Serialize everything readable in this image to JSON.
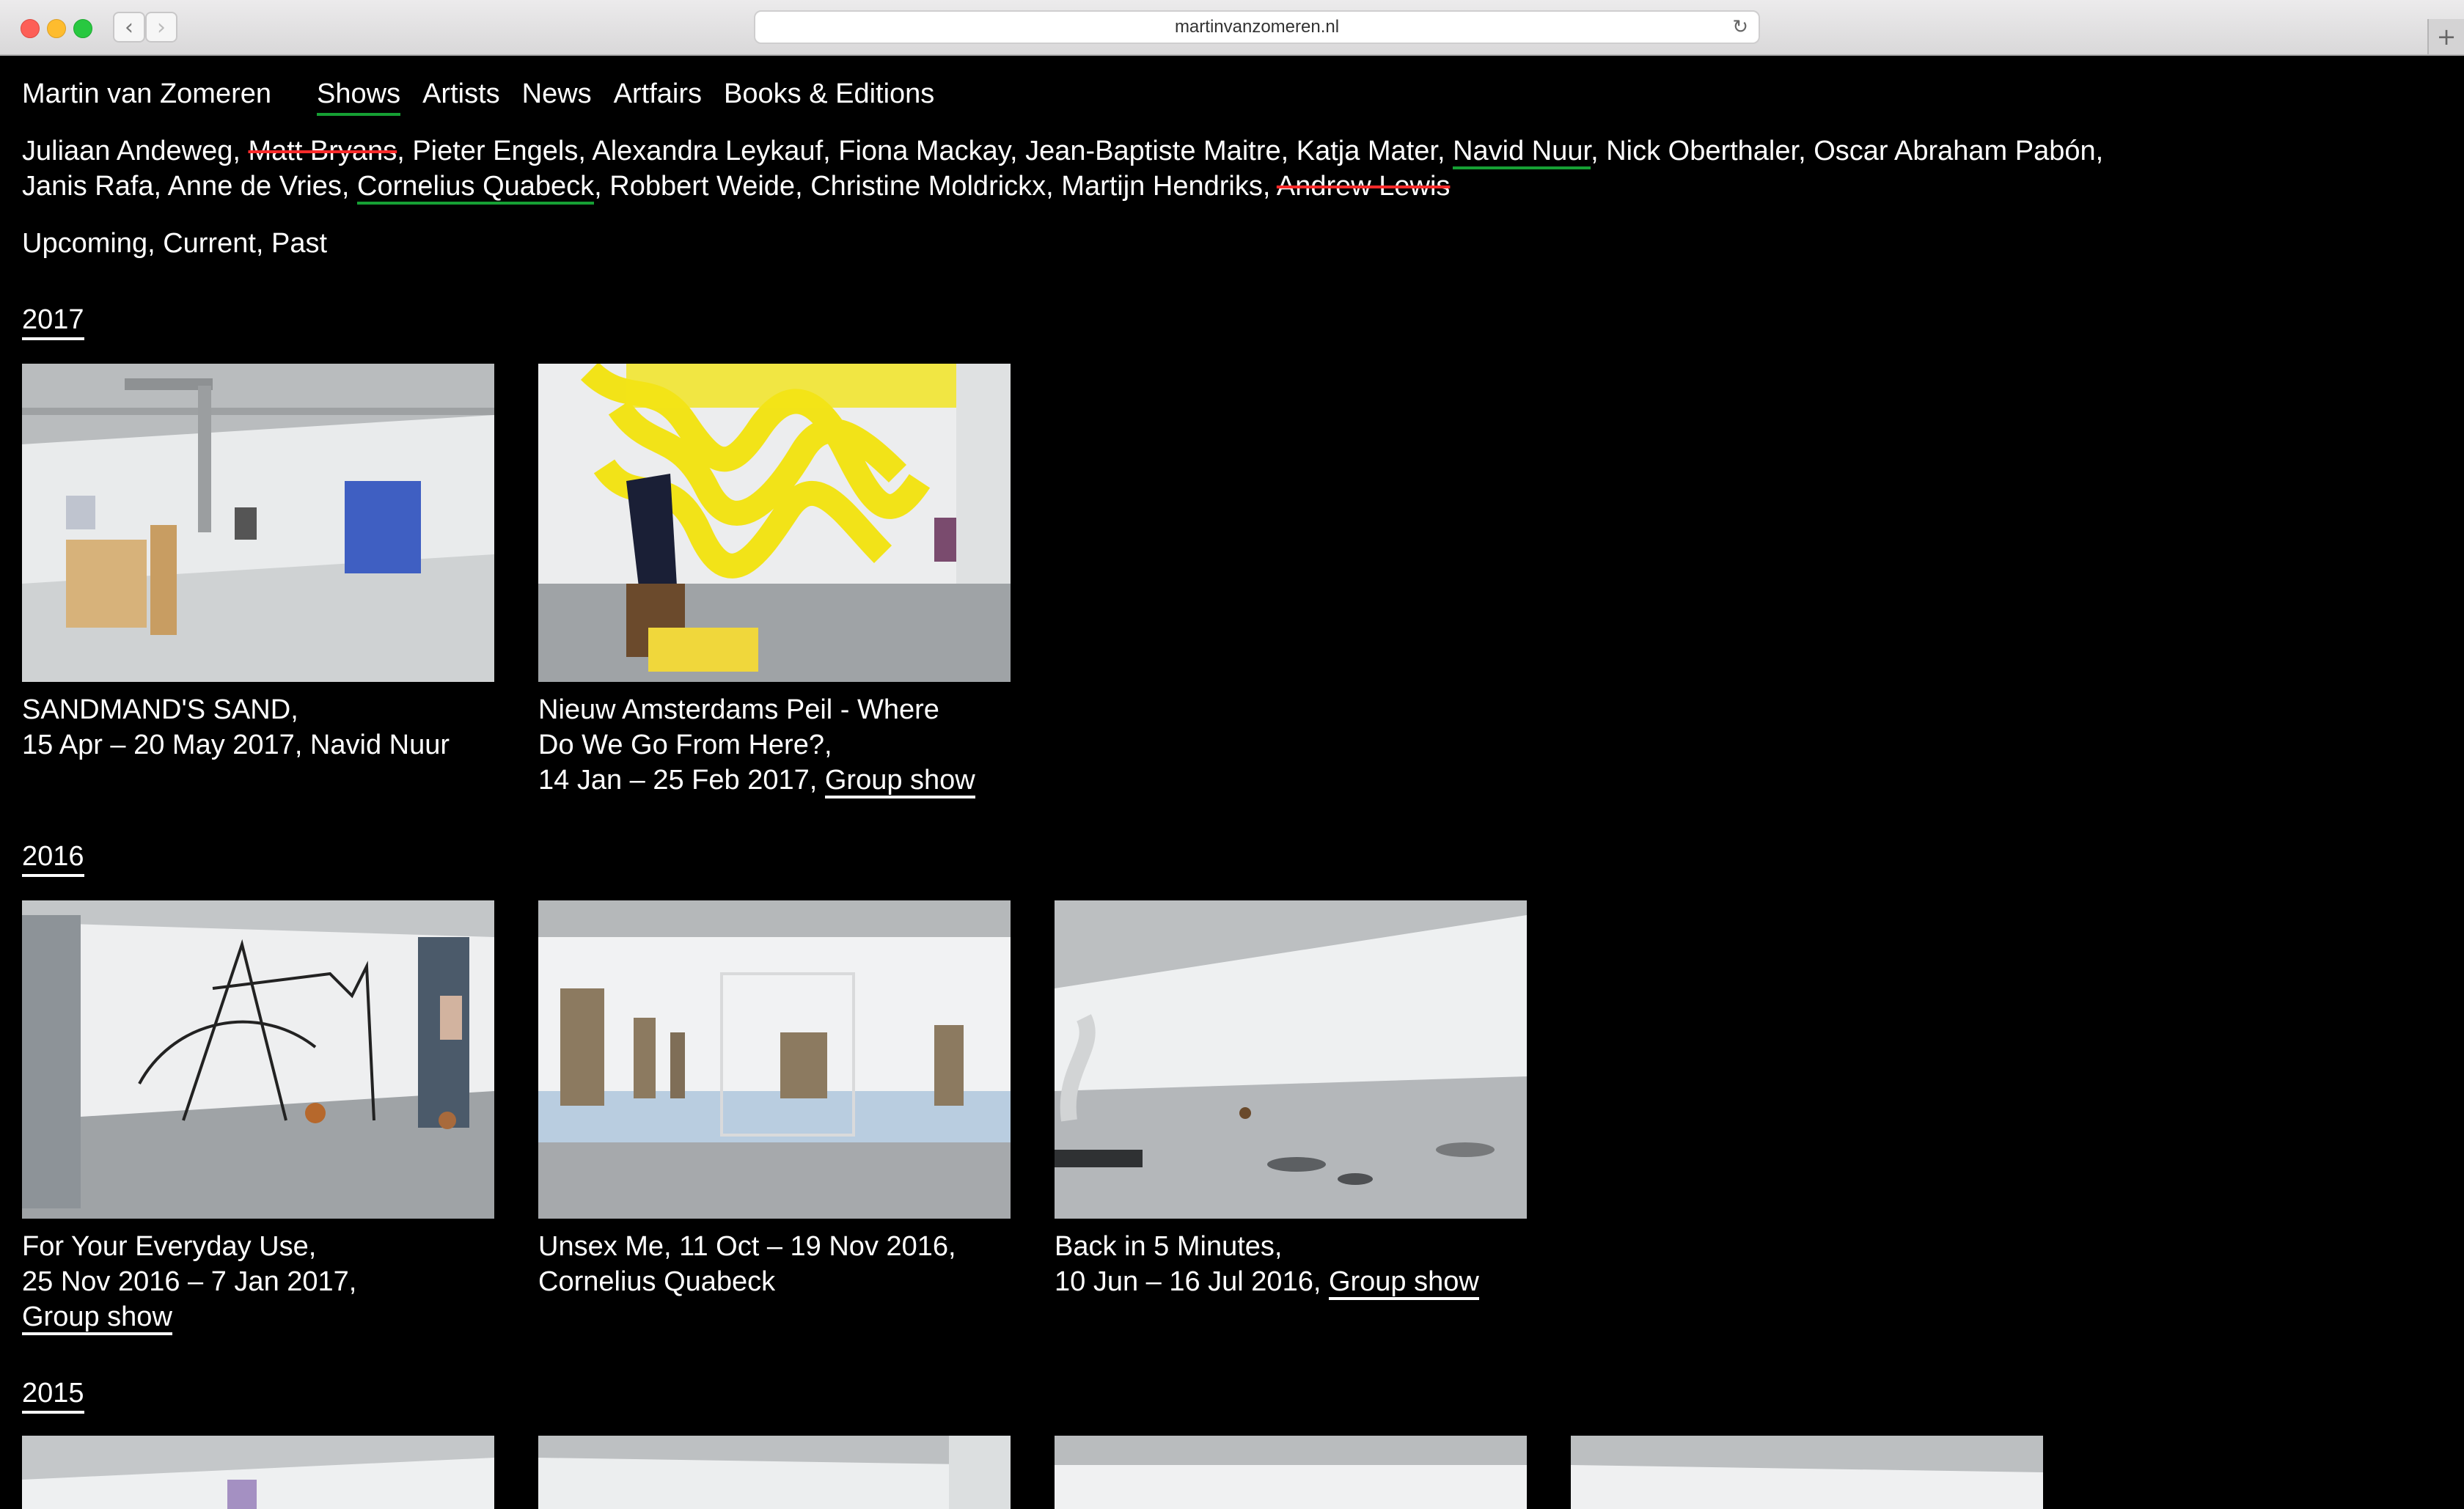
{
  "browser": {
    "url": "martinvanzomeren.nl",
    "back_glyph": "‹",
    "forward_glyph": "›",
    "reload_glyph": "↻",
    "new_tab_glyph": "+"
  },
  "site": {
    "brand": "Martin van Zomeren",
    "nav": [
      {
        "label": "Shows",
        "active": true
      },
      {
        "label": "Artists",
        "active": false
      },
      {
        "label": "News",
        "active": false
      },
      {
        "label": "Artfairs",
        "active": false
      },
      {
        "label": "Books & Editions",
        "active": false
      }
    ],
    "artists_line1": [
      {
        "name": "Juliaan Andeweg",
        "sep": ", "
      },
      {
        "name": "Matt Bryans",
        "sep": ", ",
        "struck": true
      },
      {
        "name": "Pieter Engels",
        "sep": ", "
      },
      {
        "name": "Alexandra Leykauf",
        "sep": ", "
      },
      {
        "name": "Fiona Mackay",
        "sep": ", "
      },
      {
        "name": "Jean-Baptiste Maitre",
        "sep": ", "
      },
      {
        "name": "Katja Mater",
        "sep": ", "
      },
      {
        "name": "Navid Nuur",
        "sep": ", ",
        "featured": true
      },
      {
        "name": "Nick Oberthaler",
        "sep": ", "
      },
      {
        "name": "Oscar Abraham Pabón",
        "sep": ","
      }
    ],
    "artists_line2": [
      {
        "name": "Janis Rafa",
        "sep": ", "
      },
      {
        "name": "Anne de Vries",
        "sep": ", "
      },
      {
        "name": "Cornelius Quabeck",
        "sep": ", ",
        "featured": true
      },
      {
        "name": "Robbert Weide",
        "sep": ", "
      },
      {
        "name": "Christine Moldrickx",
        "sep": ", "
      },
      {
        "name": "Martijn Hendriks",
        "sep": ", "
      },
      {
        "name": "Andrew Lewis",
        "sep": "",
        "struck": true
      }
    ],
    "filters": "Upcoming, Current, Past",
    "years": {
      "y2017": "2017",
      "y2016": "2016",
      "y2015": "2015"
    },
    "shows_2017": [
      {
        "line1": "SANDMAND'S SAND,",
        "line2": "15 Apr – 20 May 2017, Navid Nuur"
      },
      {
        "line1": "Nieuw Amsterdams Peil - Where",
        "line2": "Do We Go From Here?,",
        "line3": "14 Jan – 25 Feb 2017, ",
        "link": "Group show"
      }
    ],
    "shows_2016": [
      {
        "line1": "For Your Everyday Use,",
        "line2": "25 Nov 2016 – 7 Jan 2017,",
        "link": "Group show"
      },
      {
        "line1": "Unsex Me, 11 Oct – 19 Nov 2016,",
        "line2": "Cornelius Quabeck"
      },
      {
        "line1": "Back in 5 Minutes,",
        "line2": "10 Jun – 16 Jul 2016, ",
        "link": "Group show"
      }
    ]
  }
}
